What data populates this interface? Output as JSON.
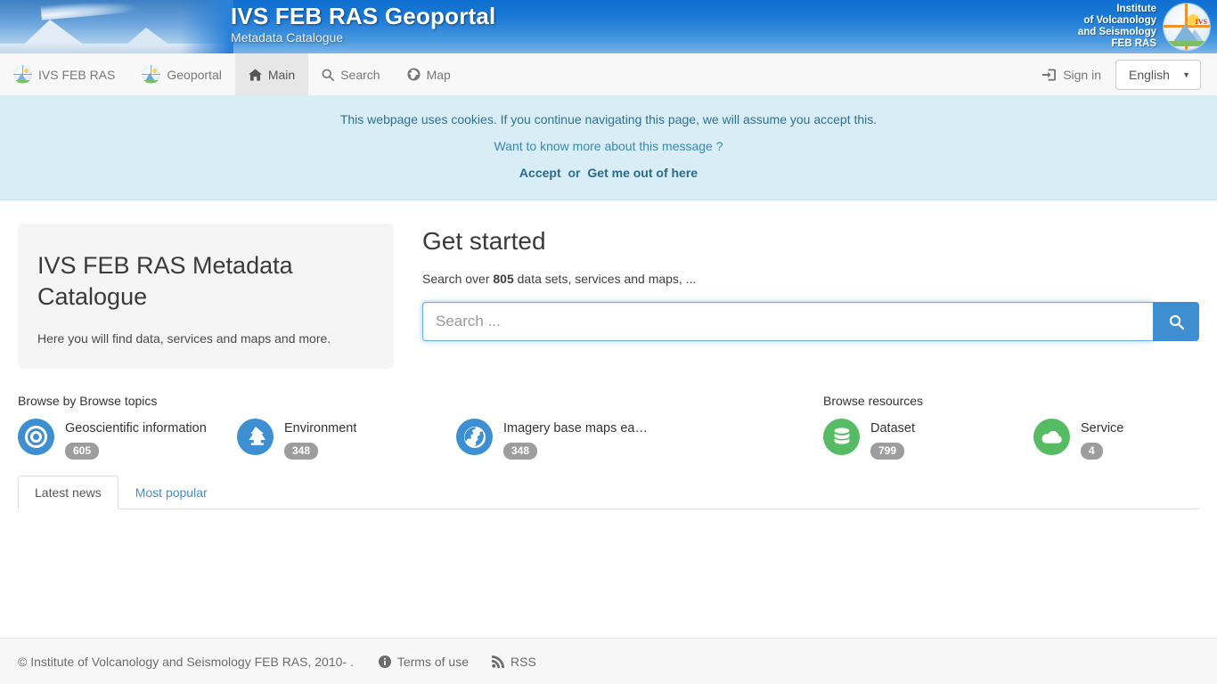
{
  "banner": {
    "title": "IVS FEB RAS Geoportal",
    "subtitle": "Metadata Catalogue",
    "institute_lines": [
      "Institute",
      "of Volcanology",
      "and Seismology",
      "FEB RAS"
    ],
    "logo_mark": "IVS"
  },
  "nav": {
    "items": [
      {
        "label": "IVS FEB RAS",
        "icon": "ivs-logo-icon",
        "active": false
      },
      {
        "label": "Geoportal",
        "icon": "geoportal-logo-icon",
        "active": false
      },
      {
        "label": "Main",
        "icon": "home-icon",
        "active": true
      },
      {
        "label": "Search",
        "icon": "search-icon",
        "active": false
      },
      {
        "label": "Map",
        "icon": "globe-icon",
        "active": false
      }
    ],
    "sign_in": "Sign in",
    "language": "English",
    "language_options": [
      "English"
    ]
  },
  "cookie": {
    "message": "This webpage uses cookies. If you continue navigating this page, we will assume you accept this.",
    "more_link": "Want to know more about this message ?",
    "accept": "Accept",
    "or": "or",
    "decline": "Get me out of here"
  },
  "jumbotron": {
    "title": "IVS FEB RAS Metadata Catalogue",
    "description": "Here you will find data, services and maps and more."
  },
  "get_started": {
    "heading": "Get started",
    "sub_prefix": "Search over",
    "count": "805",
    "sub_suffix": "data sets, services and maps, ...",
    "search_placeholder": "Search ...",
    "search_value": "",
    "search_button_icon": "search-icon"
  },
  "browse_topics": {
    "heading": "Browse by Browse topics",
    "items": [
      {
        "label": "Geoscientific information",
        "count": "605",
        "icon": "bullseye-icon",
        "color": "#3d8fd1"
      },
      {
        "label": "Environment",
        "count": "348",
        "icon": "tree-icon",
        "color": "#3d8fd1"
      },
      {
        "label": "Imagery base maps eart…",
        "count": "348",
        "icon": "globe-icon",
        "color": "#3d8fd1"
      }
    ]
  },
  "browse_resources": {
    "heading": "Browse resources",
    "items": [
      {
        "label": "Dataset",
        "count": "799",
        "icon": "database-icon",
        "color": "#56bb62"
      },
      {
        "label": "Service",
        "count": "4",
        "icon": "cloud-icon",
        "color": "#56bb62"
      }
    ]
  },
  "tabs": [
    {
      "label": "Latest news",
      "active": true
    },
    {
      "label": "Most popular",
      "active": false
    }
  ],
  "footer": {
    "copyright": "© Institute of Volcanology and Seismology FEB RAS, 2010- .",
    "terms": "Terms of use",
    "rss": "RSS"
  },
  "colors": {
    "accent_blue": "#3d8fd1",
    "accent_green": "#56bb62",
    "banner_blue": "#1d7ad6",
    "cookie_bg": "#d9edf7",
    "cookie_text": "#31708f",
    "badge_gray": "#9d9d9d"
  }
}
